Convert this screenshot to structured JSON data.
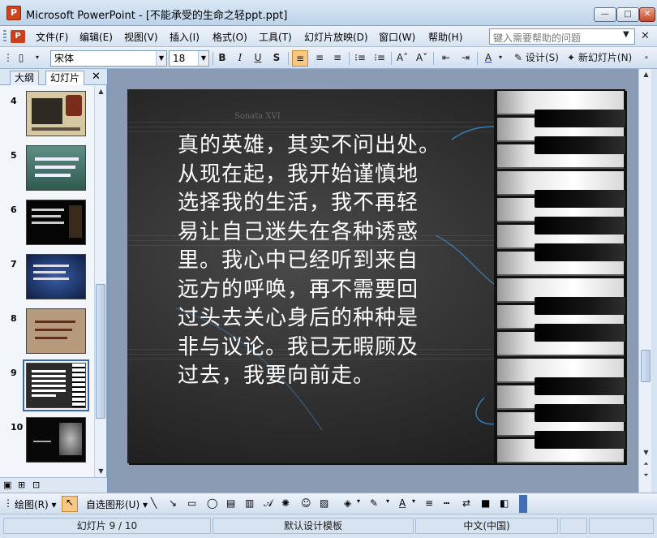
{
  "window": {
    "app_icon": "P",
    "title": "Microsoft PowerPoint - [不能承受的生命之轻ppt.ppt]",
    "min_label": "—",
    "max_label": "□",
    "close_label": "✕"
  },
  "menubar": {
    "doc_icon": "P",
    "items": [
      "文件(F)",
      "编辑(E)",
      "视图(V)",
      "插入(I)",
      "格式(O)",
      "工具(T)",
      "幻灯片放映(D)",
      "窗口(W)",
      "帮助(H)"
    ],
    "help_placeholder": "键入需要帮助的问题",
    "close_label": "✕"
  },
  "toolbar": {
    "font_name": "宋体",
    "font_size": "18",
    "bold": "B",
    "italic": "I",
    "underline": "U",
    "shadow": "S",
    "design_label": "设计(S)",
    "new_slide_label": "新幻灯片(N)"
  },
  "left_pane": {
    "tabs": [
      "大纲",
      "幻灯片"
    ],
    "close_label": "✕",
    "thumbnails": [
      {
        "number": "4",
        "style": "tan"
      },
      {
        "number": "5",
        "style": "teal"
      },
      {
        "number": "6",
        "style": "black"
      },
      {
        "number": "7",
        "style": "blue"
      },
      {
        "number": "8",
        "style": "parchment"
      },
      {
        "number": "9",
        "style": "piano",
        "selected": true
      },
      {
        "number": "10",
        "style": "dark"
      }
    ]
  },
  "slide": {
    "watermark": "Sonata XVI",
    "lines": [
      "真的英雄，其实不问出处。",
      "从现在起，我开始谨慎地",
      "选择我的生活，我不再轻",
      "易让自己迷失在各种诱惑",
      "里。我心中已经听到来自",
      "远方的呼唤，再不需要回",
      "过头去关心身后的种种是",
      "非与议论。我已无暇顾及",
      "过去，我要向前走。"
    ]
  },
  "drawbar": {
    "draw_label": "绘图(R)",
    "autoshapes_label": "自选图形(U)"
  },
  "statusbar": {
    "slide_position": "幻灯片 9 / 10",
    "template": "默认设计模板",
    "language": "中文(中国)"
  },
  "colors": {
    "accent": "#3a67b0",
    "active_button": "#f8c883",
    "slide_bg": "#2a2a2a",
    "slide_text": "#ffffff"
  }
}
